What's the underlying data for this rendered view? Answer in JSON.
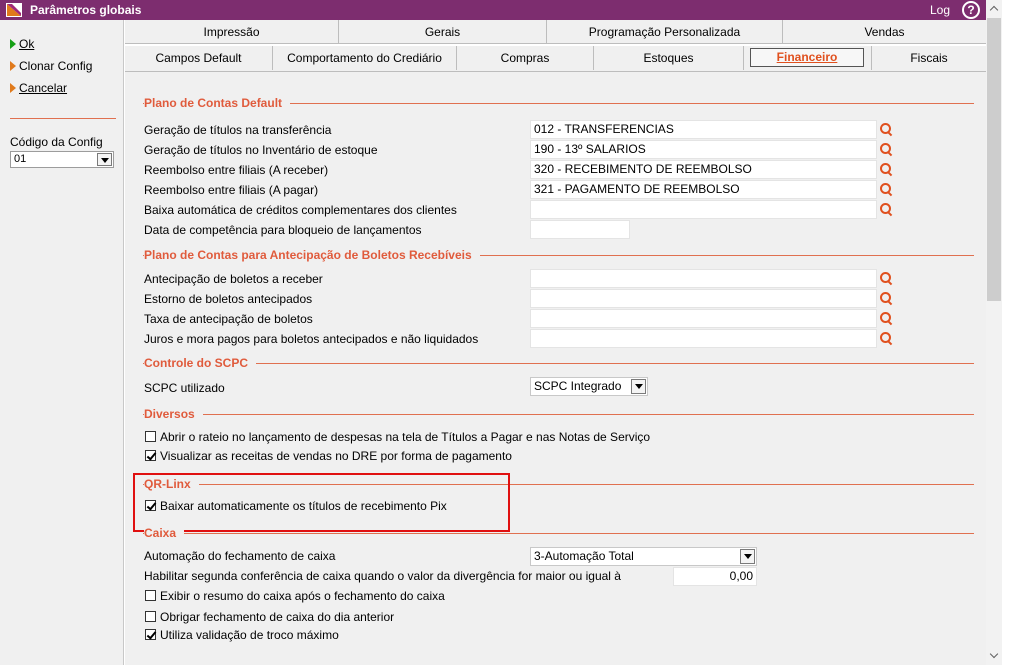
{
  "window": {
    "title": "Parâmetros globais",
    "log_label": "Log",
    "help_label": "?"
  },
  "actions": {
    "ok": "Ok",
    "clone": "Clonar Config",
    "cancel": "Cancelar"
  },
  "config": {
    "code_label": "Código da Config",
    "code_value": "01"
  },
  "tabs_top": [
    "Impressão",
    "Gerais",
    "Programação Personalizada",
    "Vendas"
  ],
  "tabs_bottom": [
    "Campos Default",
    "Comportamento do Crediário",
    "Compras",
    "Estoques",
    "Financeiro",
    "Fiscais"
  ],
  "active_tab": "Financeiro",
  "plano_default": {
    "title": "Plano de Contas Default",
    "rows": [
      {
        "label": "Geração de títulos na transferência",
        "value": "012 - TRANSFERENCIAS"
      },
      {
        "label": "Geração de títulos no Inventário de estoque",
        "value": "190 - 13º SALARIOS"
      },
      {
        "label": "Reembolso entre filiais (A receber)",
        "value": "320 - RECEBIMENTO DE REEMBOLSO"
      },
      {
        "label": "Reembolso entre filiais (A pagar)",
        "value": "321 - PAGAMENTO DE REEMBOLSO"
      },
      {
        "label": "Baixa automática de créditos complementares dos clientes",
        "value": ""
      }
    ],
    "date_label": "Data de competência para bloqueio de lançamentos",
    "date_value": ""
  },
  "plano_antecipacao": {
    "title": "Plano de Contas para Antecipação de Boletos Recebíveis",
    "rows": [
      {
        "label": "Antecipação de boletos a receber",
        "value": ""
      },
      {
        "label": "Estorno de boletos antecipados",
        "value": ""
      },
      {
        "label": "Taxa de antecipação de boletos",
        "value": ""
      },
      {
        "label": "Juros e mora pagos para boletos antecipados e não liquidados",
        "value": ""
      }
    ]
  },
  "scpc": {
    "title": "Controle do SCPC",
    "label": "SCPC utilizado",
    "value": "SCPC Integrado"
  },
  "diversos": {
    "title": "Diversos",
    "items": [
      {
        "label": "Abrir o rateio no lançamento de despesas na tela de Títulos a Pagar e nas Notas de Serviço",
        "checked": false
      },
      {
        "label": "Visualizar as receitas de vendas no DRE por forma de pagamento",
        "checked": true
      }
    ]
  },
  "qrlinx": {
    "title": "QR-Linx",
    "items": [
      {
        "label": "Baixar automaticamente os títulos de recebimento Pix",
        "checked": true
      }
    ]
  },
  "caixa": {
    "title": "Caixa",
    "automacao_label": "Automação do fechamento de caixa",
    "automacao_value": "3-Automação Total",
    "segunda_label": "Habilitar segunda conferência de caixa quando o valor da divergência for maior ou igual à",
    "segunda_value": "0,00",
    "items": [
      {
        "label": "Exibir o resumo do caixa após o fechamento do caixa",
        "checked": false
      },
      {
        "label": "Obrigar fechamento de caixa do dia anterior",
        "checked": false
      },
      {
        "label": "Utiliza validação de troco máximo",
        "checked": true
      }
    ]
  },
  "colors": {
    "titlebar": "#7d2d6f",
    "section": "#e05b3c",
    "highlight": "#e01010",
    "accent": "#e0501e"
  }
}
